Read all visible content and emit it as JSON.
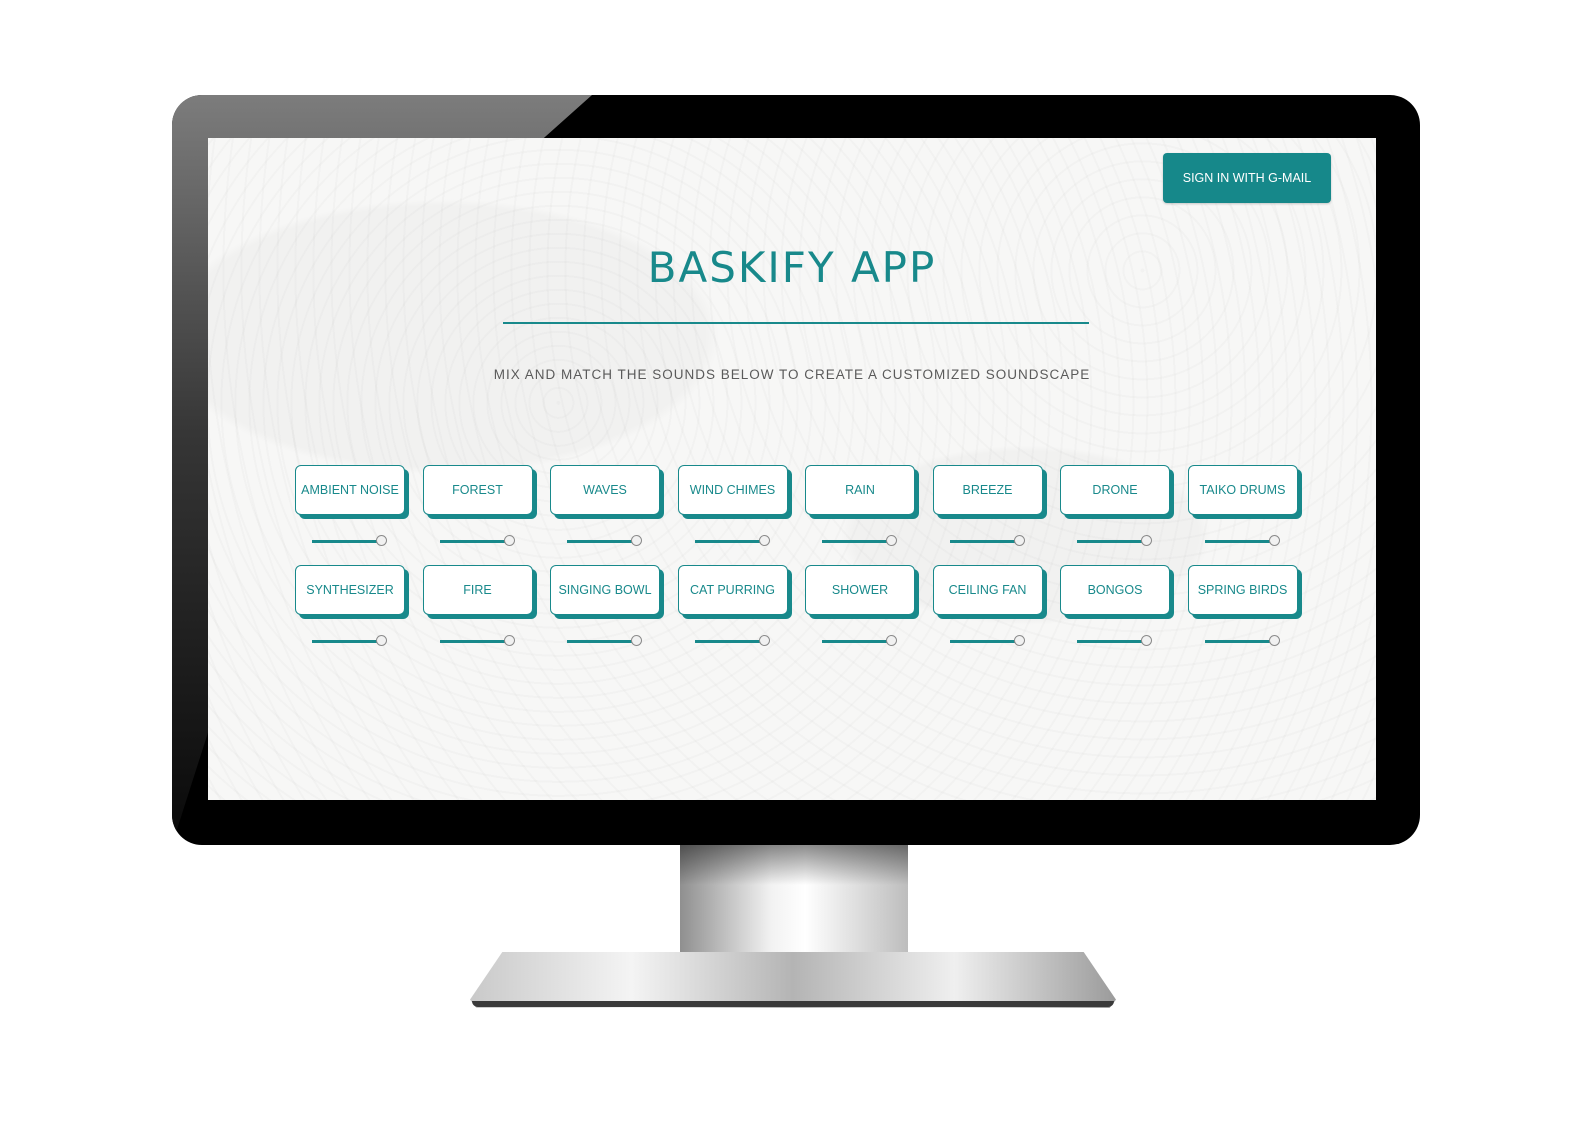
{
  "header": {
    "signin_label": "SIGN IN WITH G-MAIL",
    "title": "BASKIFY APP",
    "subtitle": "MIX AND MATCH THE SOUNDS BELOW TO CREATE A CUSTOMIZED SOUNDSCAPE"
  },
  "colors": {
    "accent": "#18898b",
    "background": "#f7f7f6"
  },
  "sounds": [
    {
      "label": "AMBIENT NOISE",
      "volume": 1.0
    },
    {
      "label": "FOREST",
      "volume": 1.0
    },
    {
      "label": "WAVES",
      "volume": 1.0
    },
    {
      "label": "WIND CHIMES",
      "volume": 1.0
    },
    {
      "label": "RAIN",
      "volume": 1.0
    },
    {
      "label": "BREEZE",
      "volume": 1.0
    },
    {
      "label": "DRONE",
      "volume": 1.0
    },
    {
      "label": "TAIKO DRUMS",
      "volume": 1.0
    },
    {
      "label": "SYNTHESIZER",
      "volume": 1.0
    },
    {
      "label": "FIRE",
      "volume": 1.0
    },
    {
      "label": "SINGING BOWL",
      "volume": 1.0
    },
    {
      "label": "CAT PURRING",
      "volume": 1.0
    },
    {
      "label": "SHOWER",
      "volume": 1.0
    },
    {
      "label": "CEILING FAN",
      "volume": 1.0
    },
    {
      "label": "BONGOS",
      "volume": 1.0
    },
    {
      "label": "SPRING BIRDS",
      "volume": 1.0
    }
  ]
}
